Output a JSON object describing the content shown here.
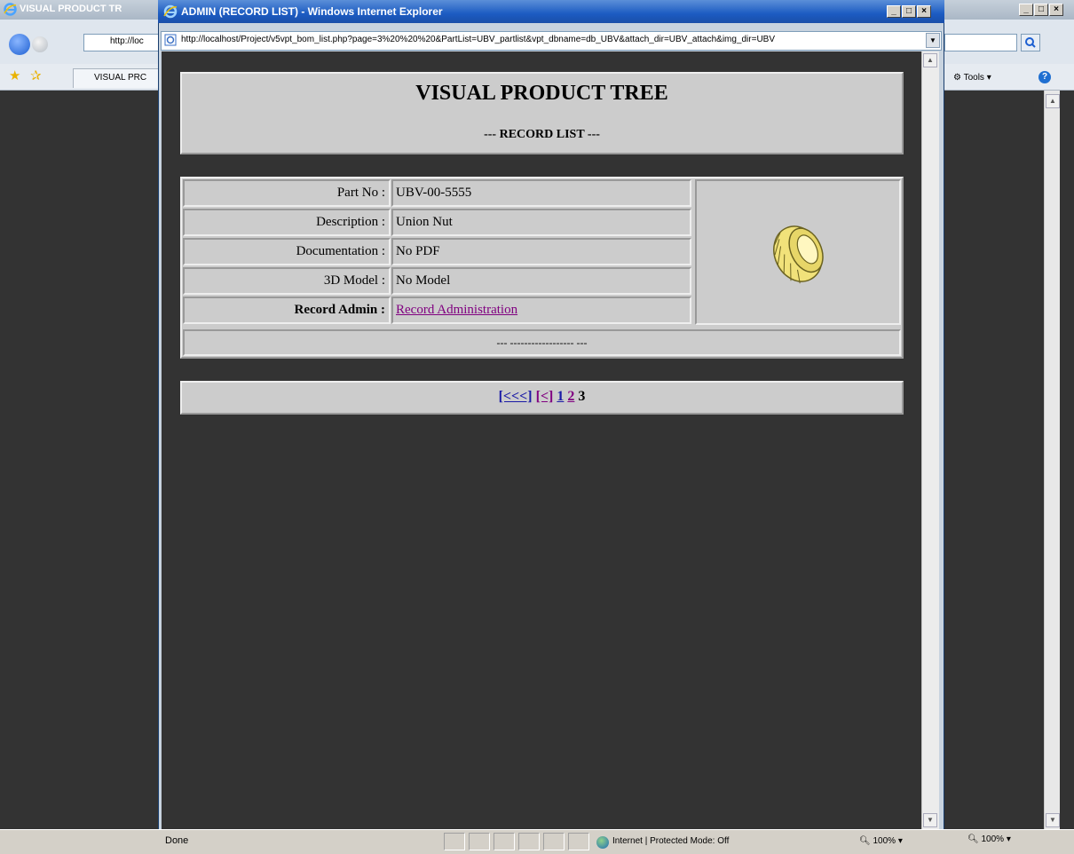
{
  "background_window": {
    "title": "VISUAL PRODUCT TR",
    "address": "http://loc",
    "tab_label": "VISUAL PRC",
    "tools_label": "Tools",
    "zoom": "100%"
  },
  "popup_window": {
    "title": "ADMIN (RECORD LIST) - Windows Internet Explorer",
    "address": "http://localhost/Project/v5vpt_bom_list.php?page=3%20%20%20&PartList=UBV_partlist&vpt_dbname=db_UBV&attach_dir=UBV_attach&img_dir=UBV",
    "status_text": "Done",
    "zone_text": "Internet | Protected Mode: Off",
    "zoom": "100%"
  },
  "page": {
    "title": "VISUAL PRODUCT TREE",
    "subtitle": "--- RECORD LIST ---",
    "record": {
      "fields": [
        {
          "label": "Part No :",
          "value": "UBV-00-5555"
        },
        {
          "label": "Description :",
          "value": "Union Nut"
        },
        {
          "label": "Documentation :",
          "value": "No PDF"
        },
        {
          "label": "3D Model :",
          "value": "No Model"
        }
      ],
      "admin_label": "Record Admin :",
      "admin_link": "Record Administration",
      "footer": "--- ------------------ ---",
      "image_alt": "Union Nut"
    },
    "pager": {
      "first": "[<<<]",
      "prev": "[<]",
      "pages": [
        "1",
        "2",
        "3"
      ],
      "current_page": "3"
    }
  },
  "colors": {
    "title_bar": "#1c5bc2",
    "panel_bg": "#cccccc",
    "page_bg": "#333333",
    "visited_link": "#800080",
    "link": "#1a1aa6"
  }
}
